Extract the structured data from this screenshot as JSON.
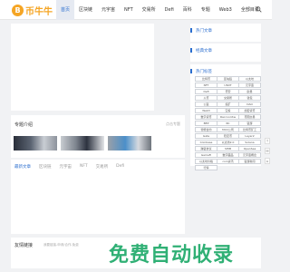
{
  "brand": {
    "logo_glyph": "B",
    "name": "币牛牛"
  },
  "nav": [
    {
      "label": "首页"
    },
    {
      "label": "区块链"
    },
    {
      "label": "元宇宙"
    },
    {
      "label": "NFT"
    },
    {
      "label": "交易所"
    },
    {
      "label": "Defi"
    },
    {
      "label": "百科"
    },
    {
      "label": "专题"
    },
    {
      "label": "Web3"
    },
    {
      "label": "全部目录"
    }
  ],
  "sidebar": {
    "hot_articles": "热门文章",
    "featured_articles": "经典文章",
    "hot_tags_title": "热门标签",
    "tags": [
      "比特币",
      "区块链",
      "以太坊",
      "NFT",
      "USDT",
      "元宇宙",
      "Defi",
      "币安",
      "欧易",
      "火币",
      "交易所",
      "钱包",
      "公链",
      "挖矿",
      "DAO",
      "Web3",
      "空投",
      "加密货币",
      "数字货币",
      "RaccoonSw",
      "币圈交易",
      "BEP",
      "RC",
      "链游",
      "智能合约",
      "MCC公司",
      "比特币矿工",
      "Gate",
      "稳定币",
      "Layer2",
      "Coinbase",
      "以太坊2.0",
      "Solana",
      "跨链协议",
      "SHIB",
      "OpenSea",
      "GameFi",
      "数字藏品",
      "元宇宙概念",
      "以太坊价格",
      "coin资讯",
      "链游新闻",
      "行情"
    ]
  },
  "topics": {
    "title": "专题介绍",
    "more": "点击专题"
  },
  "tabs": [
    {
      "label": "最新文章"
    },
    {
      "label": "区块链"
    },
    {
      "label": "元宇宙"
    },
    {
      "label": "NFT"
    },
    {
      "label": "交易所"
    },
    {
      "label": "Defi"
    }
  ],
  "friend_links": {
    "title": "友情链接",
    "note": "我要链接-申请/合作-免费"
  },
  "right_rail": {
    "up": "↑",
    "share": "✉",
    "top": "⌂"
  },
  "watermark": "免费自动收录"
}
